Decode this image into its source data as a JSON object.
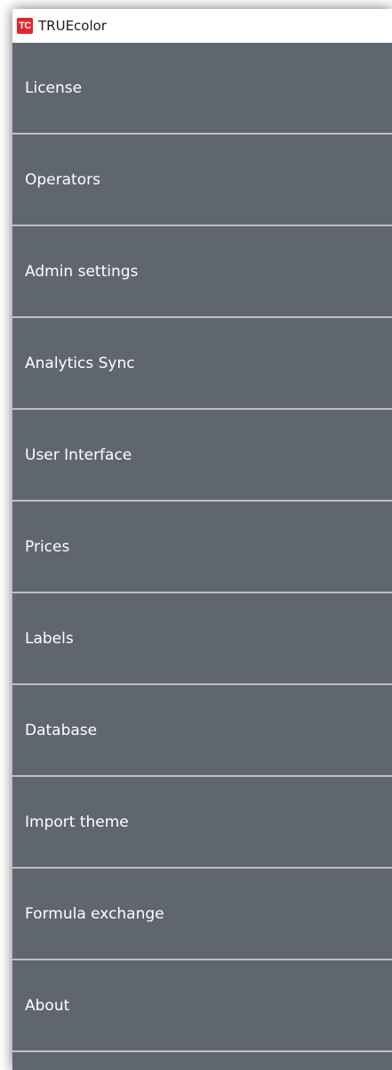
{
  "window": {
    "app_logo_text": "TC",
    "title": "TRUEcolor"
  },
  "menu": {
    "items": [
      {
        "label": "License"
      },
      {
        "label": "Operators"
      },
      {
        "label": "Admin settings"
      },
      {
        "label": "Analytics Sync"
      },
      {
        "label": "User Interface"
      },
      {
        "label": "Prices"
      },
      {
        "label": "Labels"
      },
      {
        "label": "Database"
      },
      {
        "label": "Import theme"
      },
      {
        "label": "Formula exchange"
      },
      {
        "label": "About"
      }
    ]
  },
  "colors": {
    "menu_background": "#5f6670",
    "divider": "#bcc0c6",
    "logo_red": "#e5242b",
    "menu_text": "#ffffff"
  }
}
